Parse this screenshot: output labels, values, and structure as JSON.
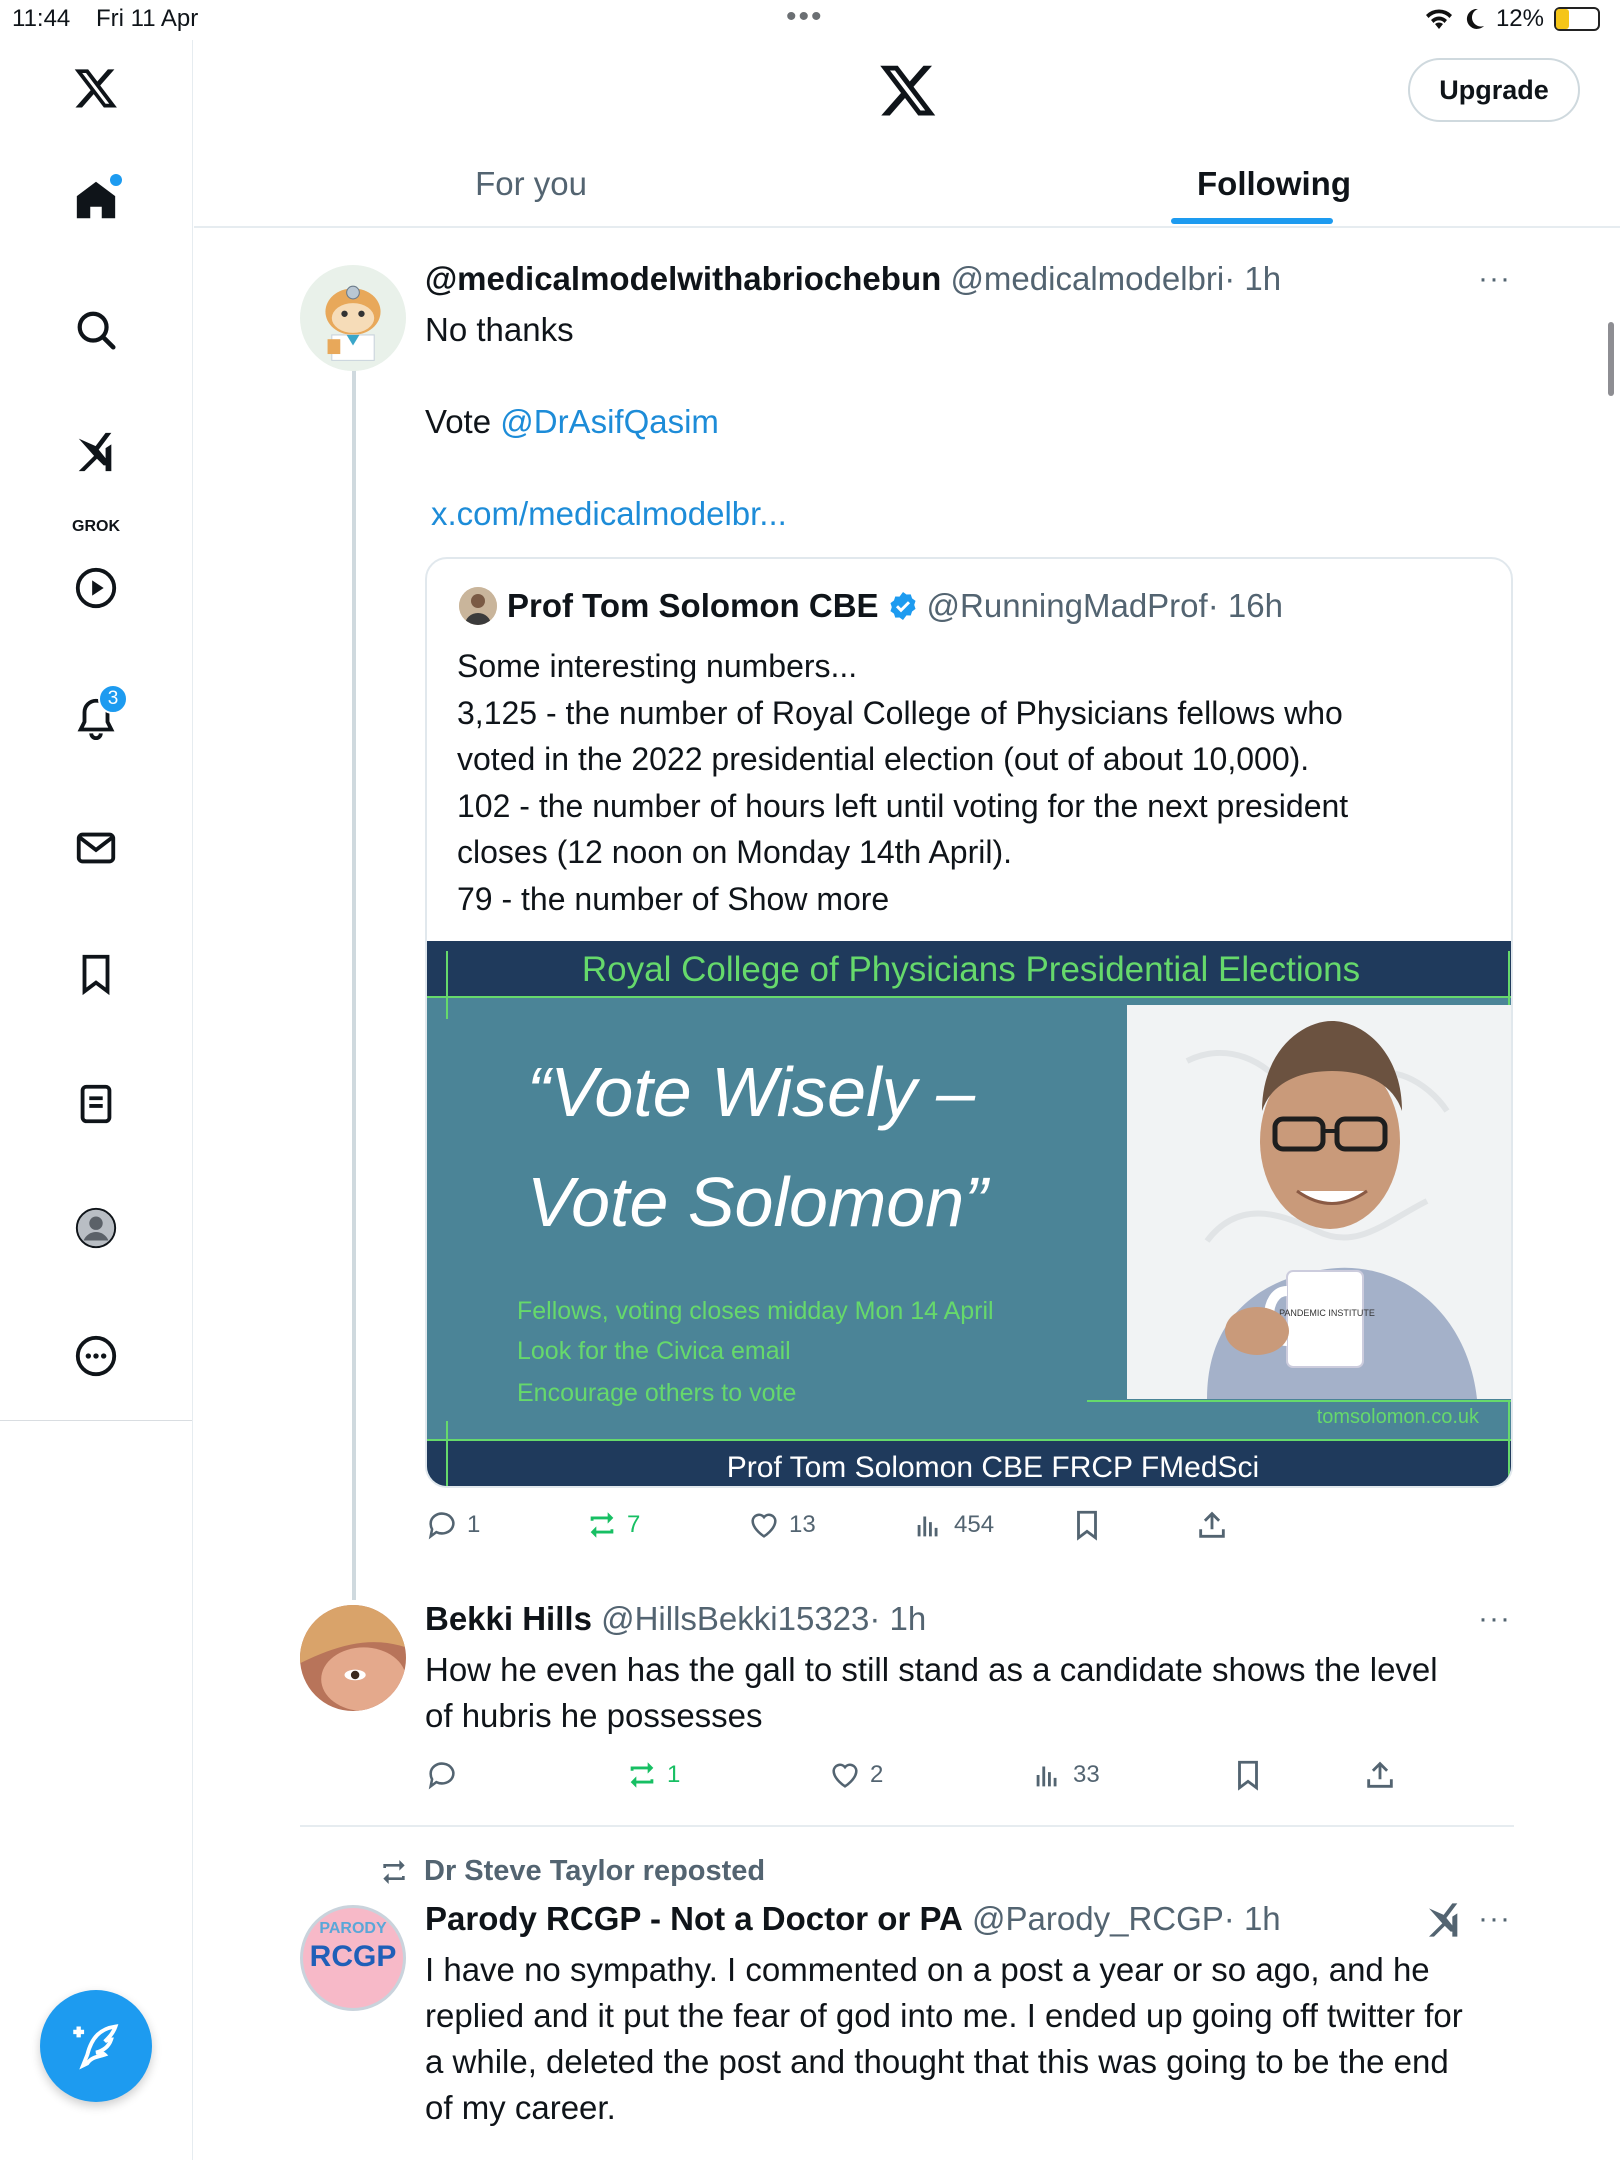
{
  "status_bar": {
    "time": "11:44",
    "date": "Fri 11 Apr",
    "battery": "12%"
  },
  "sidebar": {
    "grok_label": "GROK",
    "notifications_badge": "3",
    "items": [
      "home-icon",
      "search-icon",
      "grok-icon",
      "video-icon",
      "notifications-icon",
      "messages-icon",
      "bookmarks-icon",
      "lists-icon",
      "profile-icon",
      "more-icon"
    ]
  },
  "header": {
    "upgrade_label": "Upgrade"
  },
  "tabs": [
    {
      "label": "For you"
    },
    {
      "label": "Following"
    }
  ],
  "tweets": [
    {
      "name": "@medicalmodelwithabriochebun",
      "handle": "@medicalmodelbri",
      "time": "· 1h",
      "text_line1": "No thanks",
      "text_vote": "Vote ",
      "mention": "@DrAsifQasim",
      "link": "x.com/medicalmodelbr...",
      "quote": {
        "name": "Prof Tom Solomon CBE",
        "handle": "@RunningMadProf",
        "time": "· 16h",
        "text": [
          "Some interesting numbers...",
          "3,125 - the number of Royal College of Physicians fellows who",
          "voted in the 2022 presidential election  (out of about 10,000).",
          "102 - the number of hours left until voting for the next president",
          "closes (12 noon on Monday 14th April)."
        ],
        "text_last": "79 - the number of ",
        "show_more": "Show more",
        "image": {
          "banner": "Royal College of  Physicians Presidential Elections",
          "slogan1": "“Vote Wisely –",
          "slogan2": "Vote Solomon”",
          "line1": "Fellows, voting closes midday Mon  14 April",
          "line2": "Look for the Civica email",
          "line3": "Encourage others to vote",
          "website": "tomsolomon.co.uk",
          "footer": "Prof  Tom Solomon CBE FRCP FMedSci",
          "mug_text": "PANDEMIC INSTITUTE"
        }
      },
      "actions": {
        "replies": "1",
        "reposts": "7",
        "likes": "13",
        "views": "454"
      }
    },
    {
      "name": "Bekki Hills",
      "handle": "@HillsBekki15323",
      "time": "· 1h",
      "text": [
        "How he even has the gall to still stand as a candidate shows the level",
        "of hubris he possesses"
      ],
      "actions": {
        "replies": "",
        "reposts": "1",
        "likes": "2",
        "views": "33"
      }
    },
    {
      "repost_label": "Dr Steve Taylor reposted",
      "name": "Parody RCGP - Not a Doctor or PA",
      "handle": "@Parody_RCGP",
      "time": "· 1h",
      "avatar_top": "PARODY",
      "avatar_main": "RCGP",
      "text": [
        "I have no sympathy. I commented on a post a year or so ago, and he",
        "replied and it put the fear of god into me. I ended up going off twitter for",
        "a while, deleted the post and thought that this was going to be the end",
        "of my career."
      ]
    }
  ],
  "colors": {
    "accent": "#1d9bf0",
    "link": "#1d8cd8",
    "repost_green": "#17bf63",
    "image_teal": "#4b8497",
    "image_navy": "#1f3a5c"
  }
}
